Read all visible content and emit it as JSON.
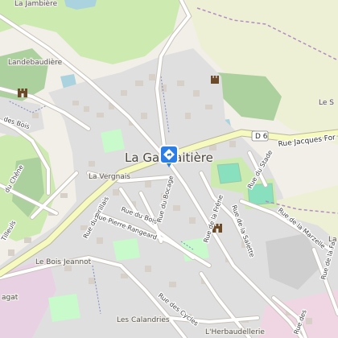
{
  "map": {
    "town": "La Gaudaitière",
    "road_shield": "D 6",
    "colors": {
      "background": "#f2efe9",
      "residential": "#e0dfdf",
      "building": "#d6d0c8",
      "forest": "#add19e",
      "grass": "#cdebb0",
      "park": "#c8facc",
      "pitch": "#88e0be",
      "farmland": "#eef0d5",
      "water": "#aad3df",
      "secondary_road": "#f7fabf",
      "road_casing": "#b9b79b",
      "minor_road": "#ffffff",
      "boundary": "#b08cc2",
      "marker": "#2a7ee6"
    },
    "labels": {
      "top_left_place": "La Jambière",
      "landebaudiere": "Landebaudière",
      "la_vergnais": "La Vergnais",
      "le_bois_jeannot": "Le Bois Jeannot",
      "les_calandries": "Les Calandries",
      "l_herbaudellerie": "L'Herbaudellerie",
      "right_place_1": "Le S",
      "right_place_2": "La",
      "bottom_left_place": "agat"
    },
    "streets": {
      "rue_jacques": "Rue Jacques For",
      "rue_du_drillais": "Rue du Drillais",
      "rue_du_bois": "Rue du Bois",
      "rue_du_bocage": "Rue du Bocage",
      "rue_pierre_rangeard": "Rue Pierre Rangeard",
      "rue_de_la_frene": "Rue de la Frêne",
      "rue_de_la_salette": "Rue de la Salette",
      "rue_du_stade": "Rue du Stade",
      "rue_de_la_marzelle": "Rue de la Marzelle",
      "rue_des_cycles": "Rue des Cycles",
      "rue_des_bois": "des Bois",
      "rue_du_chene": "du Chêne",
      "rue_des_tilleuls": "Tilleuls",
      "rue_de_la_fa": "Rue de la Fa",
      "rue_des": "Rue des"
    }
  }
}
